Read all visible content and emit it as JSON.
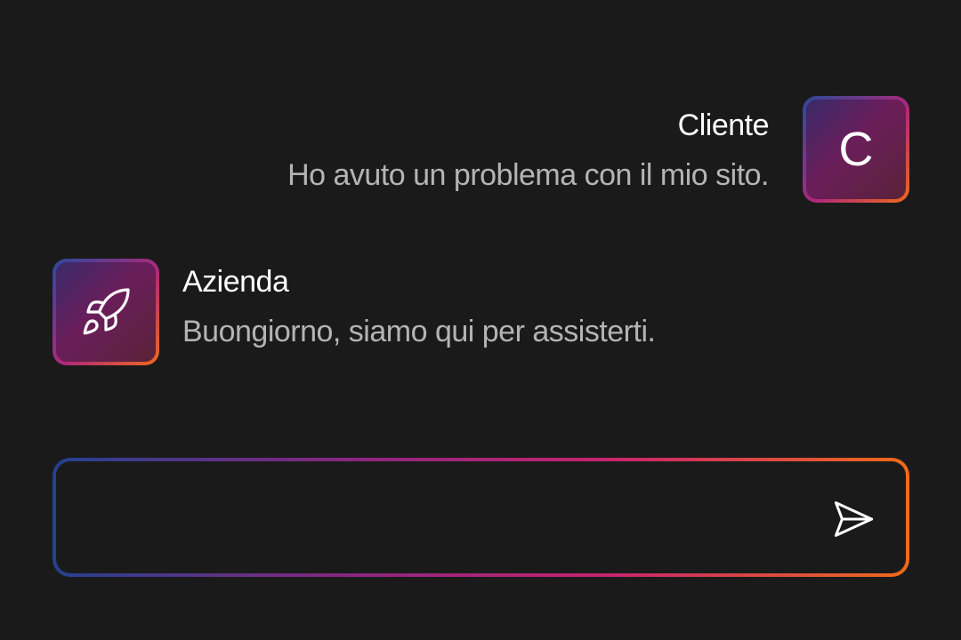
{
  "conversation": {
    "messages": [
      {
        "sender": "Cliente",
        "avatar_letter": "C",
        "text": "Ho avuto un problema con il mio sito."
      },
      {
        "sender": "Azienda",
        "avatar_icon": "rocket-icon",
        "text": "Buongiorno, siamo qui per assisterti."
      }
    ]
  },
  "composer": {
    "value": "",
    "placeholder": "",
    "send_icon": "send-icon"
  },
  "colors": {
    "background": "#1a1a1a",
    "gradient_start": "#24418f",
    "gradient_mid": "#c8246e",
    "gradient_end": "#f06a1a",
    "name_text": "#ffffff",
    "message_text": "#b4b4b4"
  }
}
